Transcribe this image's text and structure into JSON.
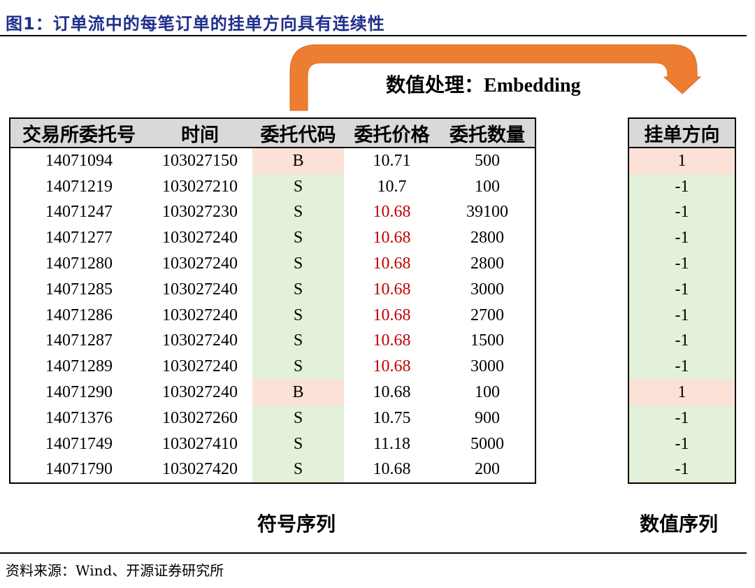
{
  "figure_title": "图1：订单流中的每笔订单的挂单方向具有连续性",
  "process_label": "数值处理：",
  "process_label_en": "Embedding",
  "main_table": {
    "headers": [
      "交易所委托号",
      "时间",
      "委托代码",
      "委托价格",
      "委托数量"
    ],
    "rows": [
      {
        "id": "14071094",
        "time": "103027150",
        "code": "B",
        "price": "10.71",
        "qty": "500",
        "price_highlight": false
      },
      {
        "id": "14071219",
        "time": "103027210",
        "code": "S",
        "price": "10.7",
        "qty": "100",
        "price_highlight": false
      },
      {
        "id": "14071247",
        "time": "103027230",
        "code": "S",
        "price": "10.68",
        "qty": "39100",
        "price_highlight": true
      },
      {
        "id": "14071277",
        "time": "103027240",
        "code": "S",
        "price": "10.68",
        "qty": "2800",
        "price_highlight": true
      },
      {
        "id": "14071280",
        "time": "103027240",
        "code": "S",
        "price": "10.68",
        "qty": "2800",
        "price_highlight": true
      },
      {
        "id": "14071285",
        "time": "103027240",
        "code": "S",
        "price": "10.68",
        "qty": "3000",
        "price_highlight": true
      },
      {
        "id": "14071286",
        "time": "103027240",
        "code": "S",
        "price": "10.68",
        "qty": "2700",
        "price_highlight": true
      },
      {
        "id": "14071287",
        "time": "103027240",
        "code": "S",
        "price": "10.68",
        "qty": "1500",
        "price_highlight": true
      },
      {
        "id": "14071289",
        "time": "103027240",
        "code": "S",
        "price": "10.68",
        "qty": "3000",
        "price_highlight": true
      },
      {
        "id": "14071290",
        "time": "103027240",
        "code": "B",
        "price": "10.68",
        "qty": "100",
        "price_highlight": false
      },
      {
        "id": "14071376",
        "time": "103027260",
        "code": "S",
        "price": "10.75",
        "qty": "900",
        "price_highlight": false
      },
      {
        "id": "14071749",
        "time": "103027410",
        "code": "S",
        "price": "11.18",
        "qty": "5000",
        "price_highlight": false
      },
      {
        "id": "14071790",
        "time": "103027420",
        "code": "S",
        "price": "10.68",
        "qty": "200",
        "price_highlight": false
      }
    ]
  },
  "direction_table": {
    "header": "挂单方向",
    "values": [
      "1",
      "-1",
      "-1",
      "-1",
      "-1",
      "-1",
      "-1",
      "-1",
      "-1",
      "1",
      "-1",
      "-1",
      "-1"
    ]
  },
  "symbol_sequence_label": "符号序列",
  "numeric_sequence_label": "数值序列",
  "source_text": "资料来源：Wind、开源证券研究所",
  "colors": {
    "title": "#1f2f8c",
    "arrow": "#ed7d31",
    "header_bg": "#d9d9d9",
    "buy_bg": "#fbe1d6",
    "sell_bg": "#e3f0da",
    "highlight_price": "#c00000"
  }
}
